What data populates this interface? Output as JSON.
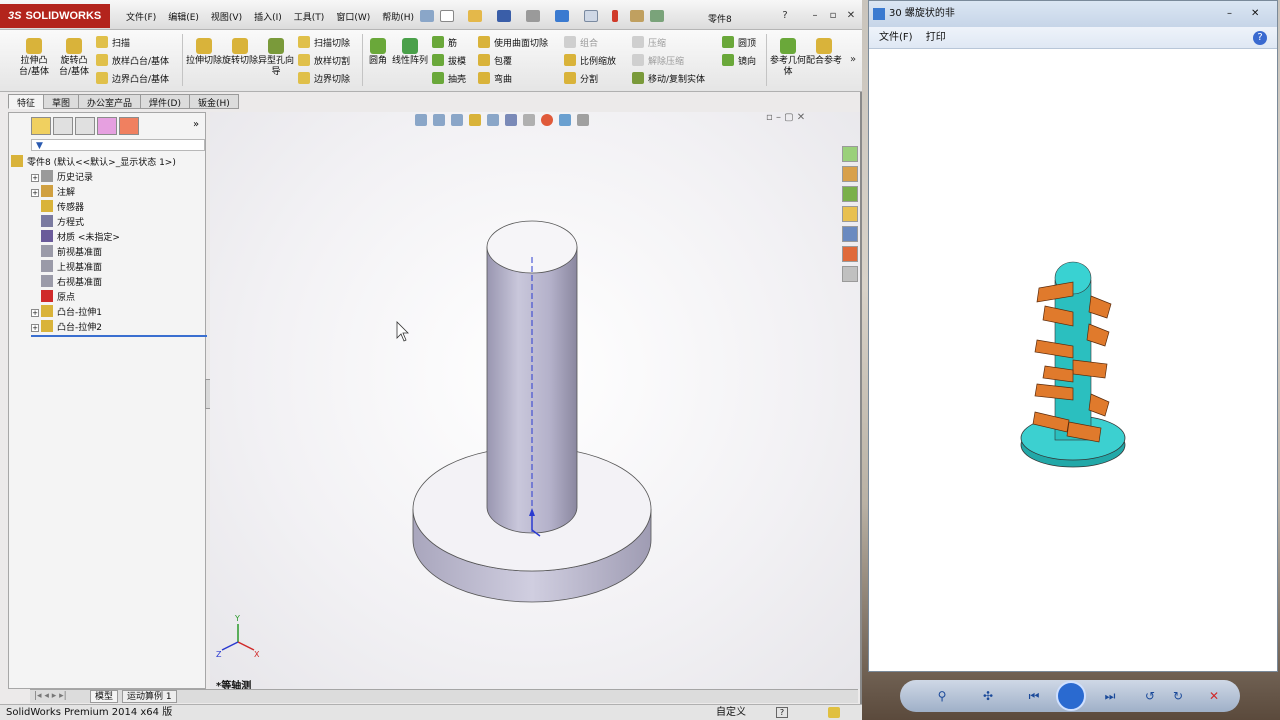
{
  "app": {
    "brand_ds": "3S",
    "brand": "SOLIDWORKS",
    "document_name": "零件8",
    "menu": [
      "文件(F)",
      "编辑(E)",
      "视图(V)",
      "插入(I)",
      "工具(T)",
      "窗口(W)",
      "帮助(H)"
    ]
  },
  "commands": {
    "extrude_boss": "拉伸凸台/基体",
    "revolve_boss": "旋转凸台/基体",
    "sweep": "扫描",
    "loft": "放样凸台/基体",
    "boundary_boss": "边界凸台/基体",
    "extrude_cut": "拉伸切除",
    "revolve_cut": "旋转切除",
    "hole_wizard": "异型孔向导",
    "swept_cut": "扫描切除",
    "lofted_cut": "放样切割",
    "boundary_cut": "边界切除",
    "fillet": "圆角",
    "linear_pattern": "线性阵列",
    "rib": "筋",
    "draft": "拔模",
    "shell": "抽壳",
    "surface_cut": "使用曲面切除",
    "wrap": "包覆",
    "flex": "弯曲",
    "combine": "组合",
    "scale": "比例缩放",
    "split": "分割",
    "compress": "压缩",
    "uncompress": "解除压缩",
    "move_copy": "移动/复制实体",
    "dome": "圆顶",
    "mirror": "镜向",
    "ref_geometry": "参考几何体",
    "mate_ref": "配合参考"
  },
  "tabs": [
    "特征",
    "草图",
    "办公室产品",
    "焊件(D)",
    "钣金(H)"
  ],
  "tree": {
    "root": "零件8  (默认<<默认>_显示状态 1>)",
    "items": [
      {
        "label": "历史记录",
        "expandable": true
      },
      {
        "label": "注解",
        "expandable": true
      },
      {
        "label": "传感器",
        "expandable": false
      },
      {
        "label": "方程式",
        "expandable": false
      },
      {
        "label": "材质 <未指定>",
        "expandable": false
      },
      {
        "label": "前视基准面",
        "expandable": false
      },
      {
        "label": "上视基准面",
        "expandable": false
      },
      {
        "label": "右视基准面",
        "expandable": false
      },
      {
        "label": "原点",
        "expandable": false
      },
      {
        "label": "凸台-拉伸1",
        "expandable": true
      },
      {
        "label": "凸台-拉伸2",
        "expandable": true
      }
    ]
  },
  "viewport": {
    "view_name": "*等轴测",
    "triad_x": "X",
    "triad_y": "Y",
    "triad_z": "Z"
  },
  "bottom_tabs": [
    "模型",
    "运动算例 1"
  ],
  "status": {
    "product": "SolidWorks Premium 2014 x64 版",
    "units": "自定义"
  },
  "photo_viewer": {
    "title": "30 螺旋状的非",
    "menu_file": "文件(F)",
    "menu_print": "打印"
  },
  "colors": {
    "sw_red": "#b3241c",
    "part_body": "#b8b5cb",
    "helix_orange": "#e07a2c",
    "teal": "#2bbfbf"
  }
}
